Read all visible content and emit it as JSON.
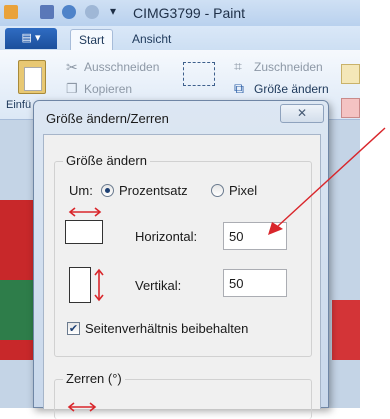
{
  "window": {
    "title": "CIMG3799 - Paint"
  },
  "ribbon": {
    "file_menu_label": "▤ ▾",
    "tabs": [
      {
        "label": "Start",
        "active": true
      },
      {
        "label": "Ansicht",
        "active": false
      }
    ],
    "clipboard": {
      "paste_label": "Einfü",
      "cut_label": "Ausschneiden",
      "copy_label": "Kopieren"
    },
    "image": {
      "crop_label": "Zuschneiden",
      "resize_label": "Größe ändern"
    }
  },
  "dialog": {
    "title": "Größe ändern/Zerren",
    "close_label": "✕",
    "resize_group": {
      "title": "Größe ändern",
      "by_label": "Um:",
      "percent_label": "Prozentsatz",
      "percent_selected": true,
      "pixel_label": "Pixel",
      "horizontal_label": "Horizontal:",
      "horizontal_value": "50",
      "vertical_label": "Vertikal:",
      "vertical_value": "50",
      "keep_ratio_label": "Seitenverhältnis beibehalten",
      "keep_ratio_checked": true
    },
    "skew_group": {
      "title": "Zerren (°)"
    }
  },
  "colors": {
    "annotation_arrow": "#d9262b",
    "dialog_frame": "#c9d8eb",
    "dialog_body": "#f0f0f0",
    "accent": "#1b4f9c"
  },
  "icons": {
    "cut": "scissors-icon",
    "copy": "copy-icon",
    "crop": "crop-icon",
    "resize": "resize-icon",
    "horizontal_resize": "horizontal-arrow-icon",
    "vertical_resize": "vertical-arrow-icon"
  }
}
